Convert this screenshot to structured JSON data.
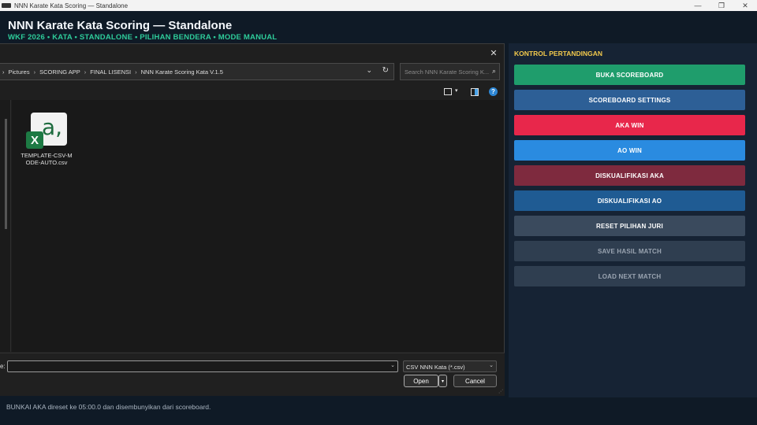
{
  "window": {
    "title": "NNN Karate Kata Scoring — Standalone",
    "controls": {
      "minimize": "—",
      "maximize": "❐",
      "close": "✕"
    }
  },
  "header": {
    "title": "NNN Karate Kata Scoring — Standalone",
    "subtitle": "WKF 2026 • KATA • STANDALONE • PILIHAN BENDERA • MODE MANUAL"
  },
  "file_dialog": {
    "close": "✕",
    "breadcrumbs": [
      "Pictures",
      "SCORING APP",
      "FINAL LISENSI",
      "NNN Karate Scoring Kata V.1.5"
    ],
    "breadcrumb_sep": "›",
    "address_chevron": "⌄",
    "refresh": "↻",
    "search_placeholder": "Search NNN Karate Scoring K...",
    "search_icon": "⌕",
    "view_caret": "▾",
    "help": "?",
    "files": [
      {
        "name": "TEMPLATE-CSV-MODE-AUTO.csv",
        "icon": "excel-icon",
        "icon_letter": "a,",
        "badge": "X"
      }
    ],
    "filename_label": "e:",
    "filename_value": "",
    "filename_caret": "⌄",
    "file_type": "CSV NNN Kata (*.csv)",
    "file_type_caret": "⌄",
    "open_label": "Open",
    "open_split": "▾",
    "cancel_label": "Cancel",
    "resize_grip": "⋰"
  },
  "panel": {
    "title": "KONTROL PERTANDINGAN",
    "buttons": [
      {
        "label": "BUKA SCOREBOARD",
        "color": "#1f9d6c"
      },
      {
        "label": "SCOREBOARD SETTINGS",
        "color": "#2d5f96"
      },
      {
        "label": "AKA WIN",
        "color": "#e8274b"
      },
      {
        "label": "AO WIN",
        "color": "#2a8be0"
      },
      {
        "label": "DISKUALIFIKASI AKA",
        "color": "#7e2a3e"
      },
      {
        "label": "DISKUALIFIKASI AO",
        "color": "#1f5b93"
      },
      {
        "label": "RESET PILIHAN JURI",
        "color": "#3a4a5d"
      },
      {
        "label": "SAVE HASIL MATCH",
        "color": "#2f3e50"
      },
      {
        "label": "LOAD NEXT MATCH",
        "color": "#2f3e50"
      }
    ]
  },
  "status": "BUNKAI AKA direset ke 05:00.0 dan disembunyikan dari scoreboard."
}
